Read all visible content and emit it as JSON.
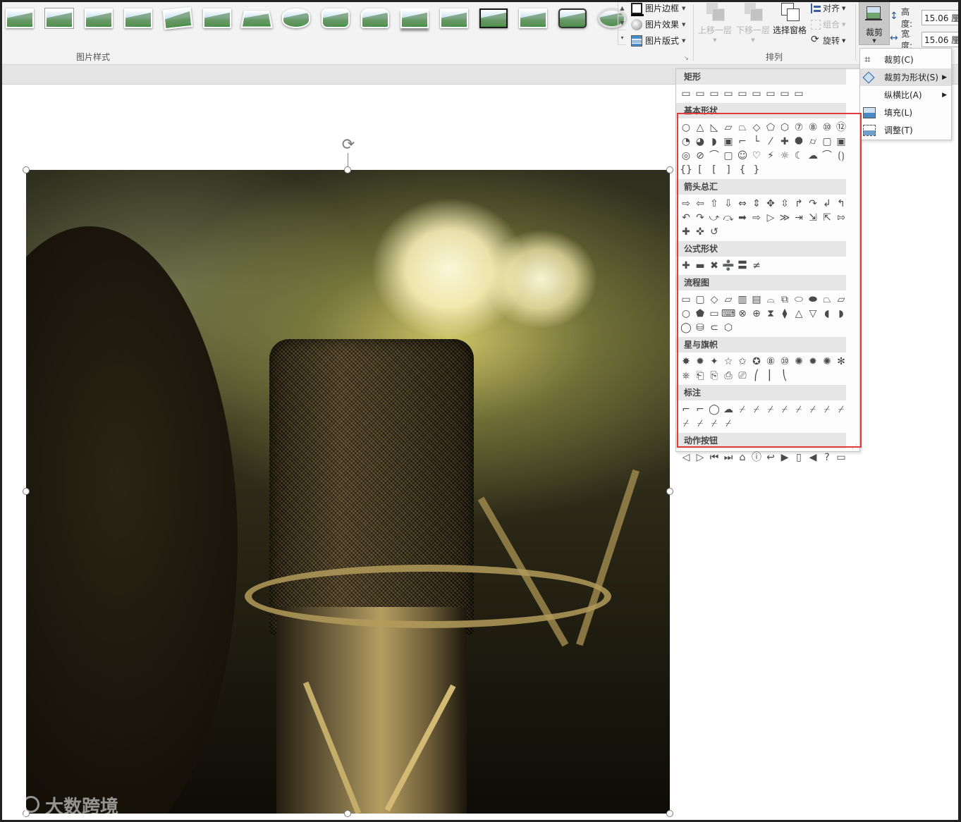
{
  "ribbon": {
    "picture_styles_group_label": "图片样式",
    "picture_border_label": "图片边框",
    "picture_effects_label": "图片效果",
    "picture_layout_label": "图片版式",
    "arrange_group_label": "排列",
    "bring_forward_label": "上移一层",
    "send_backward_label": "下移一层",
    "selection_pane_label": "选择窗格",
    "align_label": "对齐",
    "group_label": "组合",
    "rotate_label": "旋转",
    "crop_label": "裁剪",
    "height_label": "高度:",
    "height_value": "15.06 厘",
    "width_label": "宽度:",
    "width_value": "15.06 厘"
  },
  "crop_menu": {
    "items": [
      {
        "label": "裁剪(C)",
        "icon": "crop-icon"
      },
      {
        "label": "裁剪为形状(S)",
        "icon": "crop-to-shape-icon",
        "submenu": true,
        "selected": true
      },
      {
        "label": "纵横比(A)",
        "icon": "",
        "submenu": true
      },
      {
        "label": "填充(L)",
        "icon": "fill-icon"
      },
      {
        "label": "调整(T)",
        "icon": "fit-icon"
      }
    ]
  },
  "shapes_panel": {
    "categories": [
      {
        "name": "矩形",
        "count": 9
      },
      {
        "name": "基本形状",
        "count": 43
      },
      {
        "name": "箭头总汇",
        "count": 27
      },
      {
        "name": "公式形状",
        "count": 6
      },
      {
        "name": "流程图",
        "count": 28
      },
      {
        "name": "星与旗帜",
        "count": 20
      },
      {
        "name": "标注",
        "count": 16
      },
      {
        "name": "动作按钮",
        "count": 12
      }
    ]
  },
  "watermark": {
    "text": "大数跨境"
  },
  "colors": {
    "highlight": "#e23b3b",
    "ribbon_bg": "#f3f3f3",
    "crop_button_active": "#c8c8c8"
  }
}
